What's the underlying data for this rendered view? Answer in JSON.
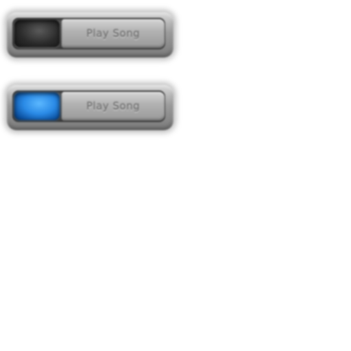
{
  "buttons": [
    {
      "label": "Play Song",
      "state": "off",
      "indicator_color": "#2a2a2a"
    },
    {
      "label": "Play Song",
      "state": "on",
      "indicator_color": "#2a8ae6"
    }
  ]
}
